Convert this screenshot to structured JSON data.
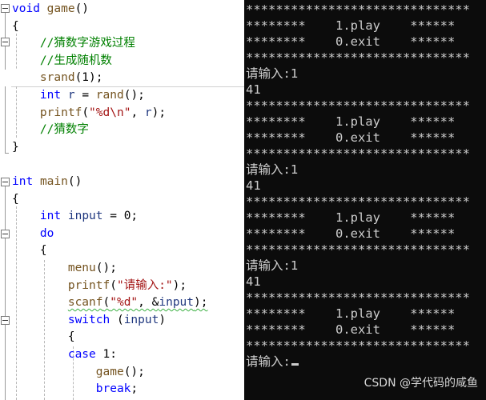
{
  "editor": {
    "lines": [
      "void game()",
      "{",
      "    //猜数字游戏过程",
      "    //生成随机数",
      "    srand(1);",
      "    int r = rand();",
      "    printf(\"%d\\n\", r);",
      "    //猜数字",
      "}",
      "",
      "int main()",
      "{",
      "    int input = 0;",
      "    do",
      "    {",
      "        menu();",
      "        printf(\"请输入:\");",
      "        scanf(\"%d\", &input);",
      "        switch (input)",
      "        {",
      "        case 1:",
      "            game();",
      "            break;"
    ],
    "current_line_index": 4,
    "warning_line_index": 17
  },
  "console": {
    "lines": [
      "******************************",
      "********    1.play    ******",
      "********    0.exit    ******",
      "******************************",
      "请输入:1",
      "41",
      "******************************",
      "********    1.play    ******",
      "********    0.exit    ******",
      "******************************",
      "请输入:1",
      "41",
      "******************************",
      "********    1.play    ******",
      "********    0.exit    ******",
      "******************************",
      "请输入:1",
      "41",
      "******************************",
      "********    1.play    ******",
      "********    0.exit    ******",
      "******************************",
      "请输入:"
    ],
    "cursor_visible": true
  },
  "watermark": {
    "text": "CSDN @学代码的咸鱼"
  },
  "colors": {
    "keyword": "#0000ff",
    "comment": "#008000",
    "function": "#74531f",
    "variable": "#1f377f",
    "string": "#a31515",
    "console_bg": "#0c0c0c",
    "console_text": "#cccccc"
  }
}
